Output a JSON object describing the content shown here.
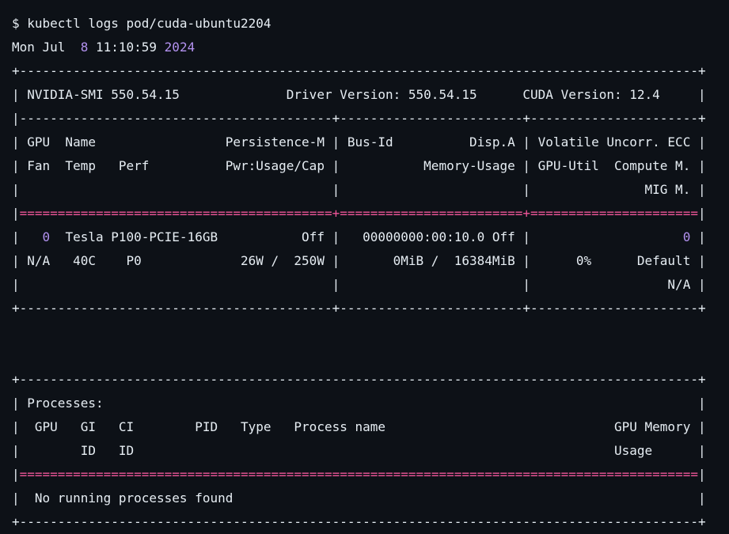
{
  "colors": {
    "background": "#0d1117",
    "text": "#e6edf3",
    "number_highlight": "#b392f0",
    "separator_highlight": "#f0569a"
  },
  "lines": [
    {
      "segments": [
        {
          "text": "$ kubectl logs pod/cuda-ubuntu2204"
        }
      ]
    },
    {
      "segments": [
        {
          "text": "Mon Jul  "
        },
        {
          "text": "8",
          "style": "num"
        },
        {
          "text": " 11:10:59 "
        },
        {
          "text": "2024",
          "style": "num"
        }
      ]
    },
    {
      "segments": [
        {
          "text": "+-----------------------------------------------------------------------------------------+"
        }
      ]
    },
    {
      "segments": [
        {
          "text": "| NVIDIA-SMI 550.54.15              Driver Version: 550.54.15      CUDA Version: 12.4     |"
        }
      ]
    },
    {
      "segments": [
        {
          "text": "|-----------------------------------------+------------------------+----------------------+"
        }
      ]
    },
    {
      "segments": [
        {
          "text": "| GPU  Name                 Persistence-M | Bus-Id          Disp.A | Volatile Uncorr. ECC |"
        }
      ]
    },
    {
      "segments": [
        {
          "text": "| Fan  Temp   Perf          Pwr:Usage/Cap |           Memory-Usage | GPU-Util  Compute M. |"
        }
      ]
    },
    {
      "segments": [
        {
          "text": "|                                         |                        |               MIG M. |"
        }
      ]
    },
    {
      "segments": [
        {
          "text": "|"
        },
        {
          "text": "=========================================+========================+======================",
          "style": "pink"
        },
        {
          "text": "|"
        }
      ]
    },
    {
      "segments": [
        {
          "text": "|   "
        },
        {
          "text": "0",
          "style": "num"
        },
        {
          "text": "  Tesla P100-PCIE-16GB           Off |   00000000:00:10.0 Off |                    "
        },
        {
          "text": "0",
          "style": "num"
        },
        {
          "text": " |"
        }
      ]
    },
    {
      "segments": [
        {
          "text": "| N/A   40C    P0             26W /  250W |       0MiB /  16384MiB |      0%      Default |"
        }
      ]
    },
    {
      "segments": [
        {
          "text": "|                                         |                        |                  N/A |"
        }
      ]
    },
    {
      "segments": [
        {
          "text": "+-----------------------------------------+------------------------+----------------------+"
        }
      ]
    },
    {
      "segments": [
        {
          "text": ""
        }
      ]
    },
    {
      "segments": [
        {
          "text": ""
        }
      ]
    },
    {
      "segments": [
        {
          "text": "+-----------------------------------------------------------------------------------------+"
        }
      ]
    },
    {
      "segments": [
        {
          "text": "| Processes:                                                                              |"
        }
      ]
    },
    {
      "segments": [
        {
          "text": "|  GPU   GI   CI        PID   Type   Process name                              GPU Memory |"
        }
      ]
    },
    {
      "segments": [
        {
          "text": "|        ID   ID                                                               Usage      |"
        }
      ]
    },
    {
      "segments": [
        {
          "text": "|"
        },
        {
          "text": "=========================================================================================",
          "style": "pink"
        },
        {
          "text": "|"
        }
      ]
    },
    {
      "segments": [
        {
          "text": "|  No running processes found                                                             |"
        }
      ]
    },
    {
      "segments": [
        {
          "text": "+-----------------------------------------------------------------------------------------+"
        }
      ]
    }
  ]
}
